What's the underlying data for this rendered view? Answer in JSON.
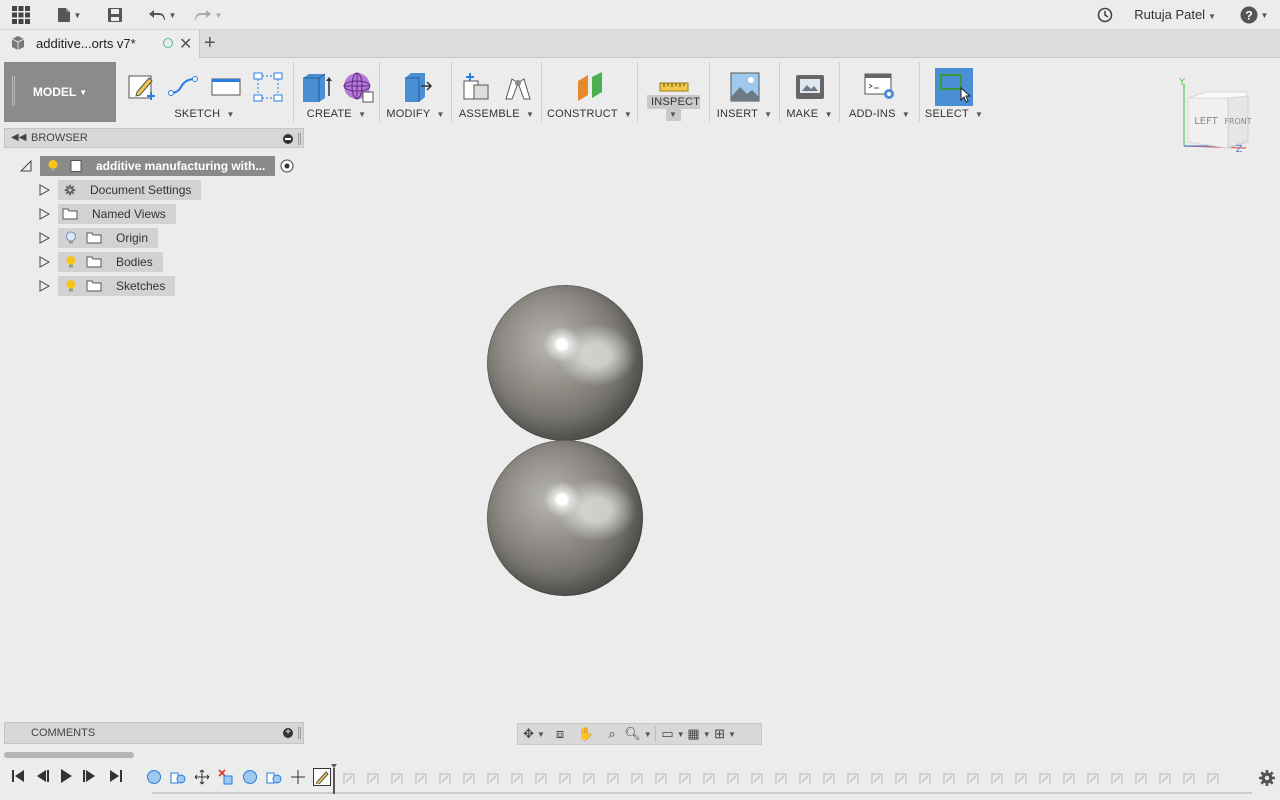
{
  "app": {
    "user_name": "Rutuja Patel"
  },
  "top_bar": {
    "icons": [
      "apps-grid-icon",
      "file-icon",
      "save-icon",
      "undo-icon",
      "redo-icon",
      "job-status-icon",
      "help-icon"
    ]
  },
  "tab": {
    "title": "additive...orts v7*",
    "new_tab_label": "+"
  },
  "toolbar": {
    "workspace": "MODEL",
    "groups": [
      {
        "label": "SKETCH"
      },
      {
        "label": "CREATE"
      },
      {
        "label": "MODIFY"
      },
      {
        "label": "ASSEMBLE"
      },
      {
        "label": "CONSTRUCT"
      },
      {
        "label": "INSPECT",
        "active": true
      },
      {
        "label": "INSERT"
      },
      {
        "label": "MAKE"
      },
      {
        "label": "ADD-INS"
      },
      {
        "label": "SELECT"
      }
    ]
  },
  "browser": {
    "title": "BROWSER",
    "root": "additive manufacturing with...",
    "items": [
      {
        "label": "Document Settings",
        "icon": "gear-icon"
      },
      {
        "label": "Named Views",
        "icon": "folder-icon"
      },
      {
        "label": "Origin",
        "icon": "folder-icon",
        "bulb": "off"
      },
      {
        "label": "Bodies",
        "icon": "folder-icon",
        "bulb": "on"
      },
      {
        "label": "Sketches",
        "icon": "folder-icon",
        "bulb": "on"
      }
    ]
  },
  "viewcube": {
    "left_face": "LEFT",
    "front_face": "FRONT",
    "axis_y": "Y",
    "axis_z": "Z"
  },
  "comments": {
    "title": "COMMENTS"
  },
  "colors": {
    "accent_blue": "#4a8fd4",
    "workspace_bg": "#8b8b8b",
    "bulb_on": "#f5c518"
  }
}
